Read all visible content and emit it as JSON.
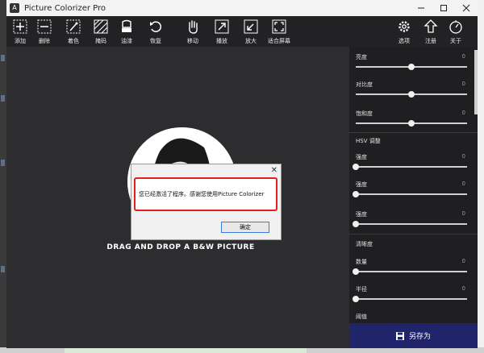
{
  "window": {
    "title": "Picture Colorizer Pro",
    "app_icon_glyph": "A"
  },
  "toolbar": {
    "left": [
      {
        "label": "添加",
        "icon": "plus-box-icon"
      },
      {
        "label": "删除",
        "icon": "minus-box-icon"
      },
      {
        "label": "着色",
        "icon": "colorize-wand-icon"
      },
      {
        "label": "掩码",
        "icon": "mask-hatch-icon"
      },
      {
        "label": "油漆",
        "icon": "paint-bucket-icon"
      },
      {
        "label": "恢复",
        "icon": "undo-icon"
      },
      {
        "label": "移动",
        "icon": "hand-icon"
      },
      {
        "label": "播放",
        "icon": "zoom-in-icon"
      },
      {
        "label": "放大",
        "icon": "zoom-out-icon"
      },
      {
        "label": "适合屏幕",
        "icon": "fit-screen-icon"
      }
    ],
    "right": [
      {
        "label": "选项",
        "icon": "gear-icon"
      },
      {
        "label": "注册",
        "icon": "register-arrow-icon"
      },
      {
        "label": "关于",
        "icon": "about-compass-icon"
      }
    ]
  },
  "canvas": {
    "drop_text": "DRAG AND DROP A B&W PICTURE"
  },
  "dialog": {
    "message": "您已经激活了程序。感谢您使用Picture Colorizer",
    "ok_label": "确定",
    "close_glyph": "✕"
  },
  "panel": {
    "sliders_top": [
      {
        "label": "亮度",
        "value": "0",
        "position": 0.5
      },
      {
        "label": "对比度",
        "value": "0",
        "position": 0.5
      },
      {
        "label": "饱和度",
        "value": "0",
        "position": 0.5
      }
    ],
    "hsv_title": "HSV 调整",
    "sliders_hsv": [
      {
        "label": "强度",
        "value": "0",
        "position": 0.0
      },
      {
        "label": "强度",
        "value": "0",
        "position": 0.0
      },
      {
        "label": "强度",
        "value": "0",
        "position": 0.0
      }
    ],
    "sharp_title": "清晰度",
    "sliders_sharp": [
      {
        "label": "数量",
        "value": "0",
        "position": 0.0
      },
      {
        "label": "半径",
        "value": "0",
        "position": 0.0
      },
      {
        "label": "阈值",
        "value": "",
        "position": 0.0
      }
    ]
  },
  "save": {
    "label": "另存为",
    "icon": "floppy-disk-icon"
  },
  "colors": {
    "accent": "#20246a",
    "dialog_highlight": "#e02020"
  }
}
